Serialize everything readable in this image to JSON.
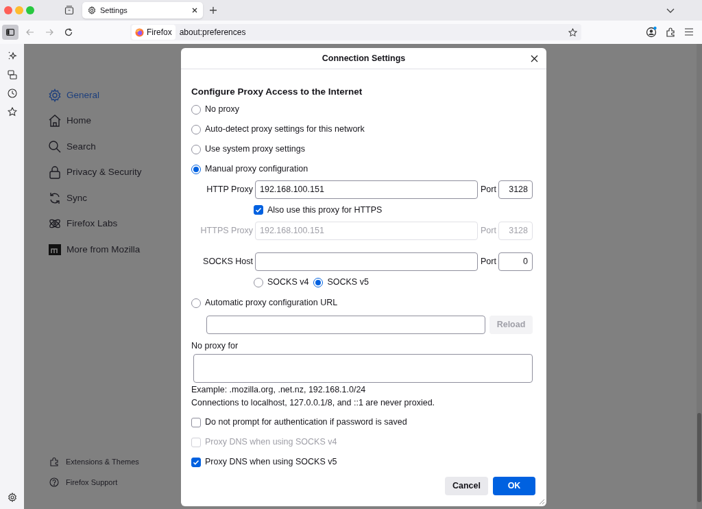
{
  "browser": {
    "tabs": [
      {
        "label": "Settings",
        "selected": true
      }
    ],
    "identity": "Firefox",
    "url": "about:preferences"
  },
  "settings_nav": {
    "items": [
      {
        "label": "General",
        "selected": true
      },
      {
        "label": "Home",
        "selected": false
      },
      {
        "label": "Search",
        "selected": false
      },
      {
        "label": "Privacy & Security",
        "selected": false
      },
      {
        "label": "Sync",
        "selected": false
      },
      {
        "label": "Firefox Labs",
        "selected": false
      },
      {
        "label": "More from Mozilla",
        "selected": false
      }
    ],
    "footer_items": [
      {
        "label": "Extensions & Themes"
      },
      {
        "label": "Firefox Support"
      }
    ]
  },
  "dialog": {
    "title": "Connection Settings",
    "heading": "Configure Proxy Access to the Internet",
    "proxy_modes": [
      {
        "label": "No proxy",
        "kind": "plain",
        "selected": false
      },
      {
        "label": "Auto-detect proxy settings for this network",
        "kind": "plain",
        "selected": false
      },
      {
        "label": "Use system proxy settings",
        "kind": "plain",
        "selected": false
      },
      {
        "label": "Manual proxy configuration",
        "kind": "manual",
        "selected": true
      },
      {
        "label": "Automatic proxy configuration URL",
        "kind": "pac",
        "selected": false
      }
    ],
    "manual": {
      "http_proxy": {
        "label": "HTTP Proxy",
        "value": "192.168.100.151",
        "port_label": "Port",
        "port": "3128",
        "disabled": false
      },
      "also_https": {
        "label": "Also use this proxy for HTTPS",
        "checked": true
      },
      "https_proxy": {
        "label": "HTTPS Proxy",
        "value": "192.168.100.151",
        "port_label": "Port",
        "port": "3128",
        "disabled": true
      },
      "socks_host": {
        "label": "SOCKS Host",
        "port_label": "Port",
        "port": "0",
        "disabled": false
      },
      "socks_versions": [
        {
          "label": "SOCKS v4",
          "selected": false
        },
        {
          "label": "SOCKS v5",
          "selected": true
        }
      ]
    },
    "pac": {
      "reload_button": {
        "label": "Reload",
        "disabled": true
      }
    },
    "no_proxy": {
      "label": "No proxy for"
    },
    "notes": [
      "Example: .mozilla.org, .net.nz, 192.168.1.0/24",
      "Connections to localhost, 127.0.0.1/8, and ::1 are never proxied."
    ],
    "options": [
      {
        "label": "Do not prompt for authentication if password is saved",
        "checked": false,
        "disabled": false
      },
      {
        "label": "Proxy DNS when using SOCKS v4",
        "checked": false,
        "disabled": true
      },
      {
        "label": "Proxy DNS when using SOCKS v5",
        "checked": true,
        "disabled": false
      }
    ],
    "buttons": [
      {
        "label": "Cancel",
        "kind": "secondary"
      },
      {
        "label": "OK",
        "kind": "primary"
      }
    ]
  }
}
